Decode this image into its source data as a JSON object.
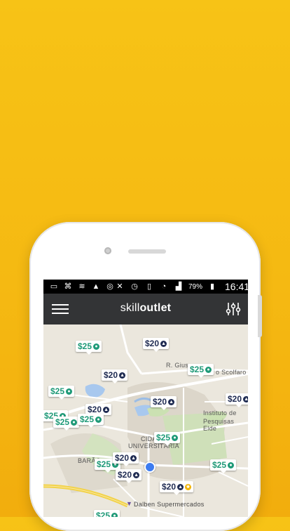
{
  "status_bar": {
    "battery": "79%",
    "time": "16:41"
  },
  "app_bar": {
    "logo_light": "skill",
    "logo_bold": "outlet"
  },
  "map": {
    "labels": [
      "R. Giuse",
      "o Scolfaro",
      "Instituto de",
      "Pesquisas Elde",
      "CIDA",
      "UNIVERSITÁRIA",
      "BARÃO",
      "Dalben Supermercados"
    ],
    "pins": [
      "$25",
      "$20",
      "$20",
      "$25",
      "$25",
      "$20",
      "$20",
      "$20",
      "$25",
      "$25",
      "$25",
      "$25",
      "$25",
      "$20",
      "$25",
      "$20",
      "$25",
      "$20"
    ]
  },
  "colors": {
    "green": "#1f9a78",
    "navy": "#1f2b52",
    "gold": "#f2b300",
    "appbar": "#333436"
  }
}
